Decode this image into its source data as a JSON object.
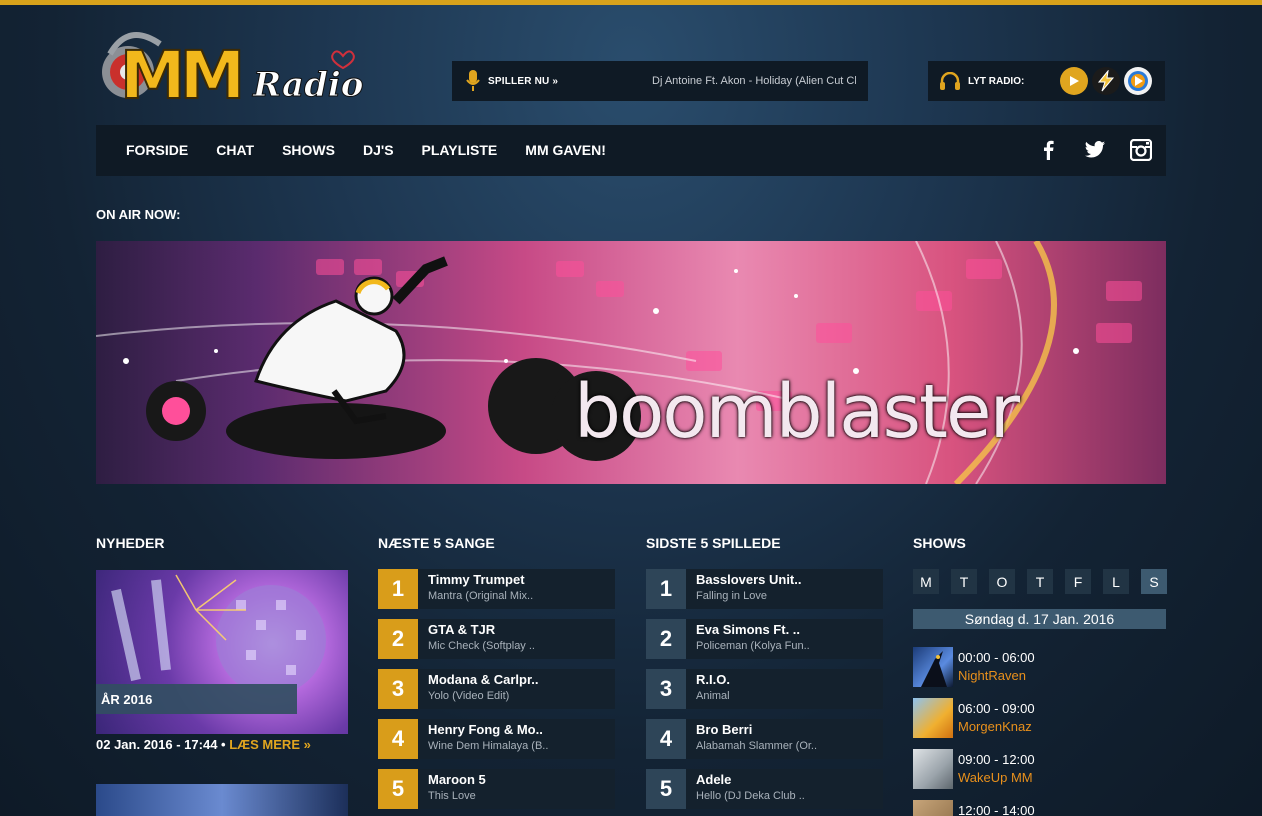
{
  "brand": {
    "logo_text": "MM",
    "logo_script": "Radio"
  },
  "now_playing": {
    "label": "SPILLER NU »",
    "track": "Dj Antoine Ft. Akon - Holiday (Alien Cut Club Mix)"
  },
  "listen": {
    "label": "LYT RADIO:",
    "players": [
      "play-icon",
      "winamp-icon",
      "media-player-icon"
    ]
  },
  "nav": {
    "items": [
      "FORSIDE",
      "CHAT",
      "SHOWS",
      "DJ'S",
      "PLAYLISTE",
      "MM GAVEN!"
    ],
    "social": [
      "facebook-icon",
      "twitter-icon",
      "instagram-icon"
    ]
  },
  "onair": {
    "title": "ON AIR NOW:",
    "banner_text": "boomblaster"
  },
  "news": {
    "title": "NYHEDER",
    "caption": "ÅR 2016",
    "date": "02 Jan. 2016 - 17:44",
    "separator": " • ",
    "more": "LÆS MERE »"
  },
  "next_songs": {
    "title": "NÆSTE 5 SANGE",
    "items": [
      {
        "num": "1",
        "artist": "Timmy Trumpet",
        "title": "Mantra (Original Mix.."
      },
      {
        "num": "2",
        "artist": "GTA & TJR",
        "title": "Mic Check (Softplay .."
      },
      {
        "num": "3",
        "artist": "Modana & Carlpr..",
        "title": "Yolo (Video Edit)"
      },
      {
        "num": "4",
        "artist": "Henry Fong & Mo..",
        "title": "Wine Dem Himalaya (B.."
      },
      {
        "num": "5",
        "artist": "Maroon 5",
        "title": "This Love"
      }
    ]
  },
  "last_songs": {
    "title": "SIDSTE 5 SPILLEDE",
    "items": [
      {
        "num": "1",
        "artist": "Basslovers Unit..",
        "title": "Falling in Love"
      },
      {
        "num": "2",
        "artist": "Eva Simons Ft. ..",
        "title": "Policeman (Kolya Fun.."
      },
      {
        "num": "3",
        "artist": "R.I.O.",
        "title": "Animal"
      },
      {
        "num": "4",
        "artist": "Bro Berri",
        "title": "Alabamah Slammer (Or.."
      },
      {
        "num": "5",
        "artist": "Adele",
        "title": "Hello (DJ Deka Club .."
      }
    ]
  },
  "shows": {
    "title": "SHOWS",
    "days": [
      "M",
      "T",
      "O",
      "T",
      "F",
      "L",
      "S"
    ],
    "active_day": 6,
    "date": "Søndag d. 17 Jan. 2016",
    "items": [
      {
        "time": "00:00 - 06:00",
        "name": "NightRaven"
      },
      {
        "time": "06:00 - 09:00",
        "name": "MorgenKnaz"
      },
      {
        "time": "09:00 - 12:00",
        "name": "WakeUp MM"
      },
      {
        "time": "12:00 - 14:00",
        "name": ""
      }
    ]
  }
}
